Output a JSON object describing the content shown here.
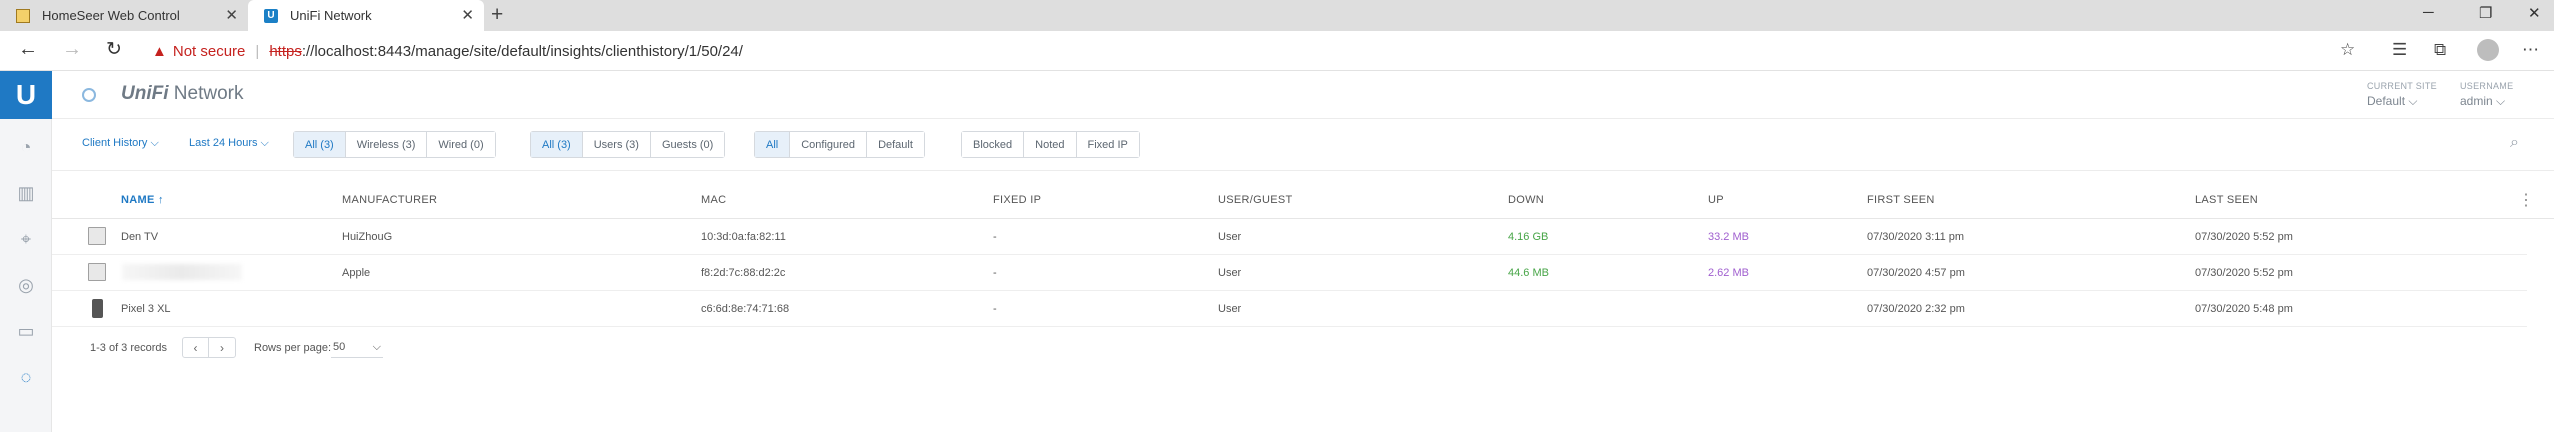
{
  "browser": {
    "tabs": [
      {
        "title": "HomeSeer Web Control",
        "icon": "homeseer-icon",
        "active": false
      },
      {
        "title": "UniFi Network",
        "icon": "unifi-icon",
        "active": true
      }
    ],
    "security_text": "Not secure",
    "url_scheme": "https",
    "url_rest": "://localhost:8443/manage/site/default/insights/clienthistory/1/50/24/"
  },
  "app": {
    "brand_bold": "UniFi",
    "brand_rest": " Network",
    "current_site_label": "CURRENT SITE",
    "current_site_value": "Default",
    "username_label": "USERNAME",
    "username_value": "admin"
  },
  "toolbar": {
    "view_select": "Client History",
    "range_select": "Last 24 Hours",
    "connection_filters": [
      "All (3)",
      "Wireless (3)",
      "Wired (0)"
    ],
    "type_filters": [
      "All (3)",
      "Users (3)",
      "Guests (0)"
    ],
    "config_filters": [
      "All",
      "Configured",
      "Default"
    ],
    "status_filters": [
      "Blocked",
      "Noted",
      "Fixed IP"
    ]
  },
  "table": {
    "columns": {
      "name": "NAME",
      "manufacturer": "MANUFACTURER",
      "mac": "MAC",
      "fixed_ip": "FIXED IP",
      "user_guest": "USER/GUEST",
      "down": "DOWN",
      "up": "UP",
      "first_seen": "FIRST SEEN",
      "last_seen": "LAST SEEN"
    },
    "sort_indicator": "↑",
    "rows": [
      {
        "name": "Den TV",
        "manufacturer": "HuiZhouG",
        "mac": "10:3d:0a:fa:82:11",
        "fixed_ip": "-",
        "user_guest": "User",
        "down": "4.16 GB",
        "up": "33.2 MB",
        "first_seen": "07/30/2020 3:11 pm",
        "last_seen": "07/30/2020 5:52 pm",
        "device": "tv"
      },
      {
        "name": "",
        "manufacturer": "Apple",
        "mac": "f8:2d:7c:88:d2:2c",
        "fixed_ip": "-",
        "user_guest": "User",
        "down": "44.6 MB",
        "up": "2.62 MB",
        "first_seen": "07/30/2020 4:57 pm",
        "last_seen": "07/30/2020 5:52 pm",
        "device": "tv"
      },
      {
        "name": "Pixel 3 XL",
        "manufacturer": "",
        "mac": "c6:6d:8e:74:71:68",
        "fixed_ip": "-",
        "user_guest": "User",
        "down": "",
        "up": "",
        "first_seen": "07/30/2020 2:32 pm",
        "last_seen": "07/30/2020 5:48 pm",
        "device": "phone"
      }
    ]
  },
  "footer": {
    "records_text": "1-3 of 3 records",
    "rows_per_page_label": "Rows per page:",
    "rows_per_page_value": "50"
  }
}
